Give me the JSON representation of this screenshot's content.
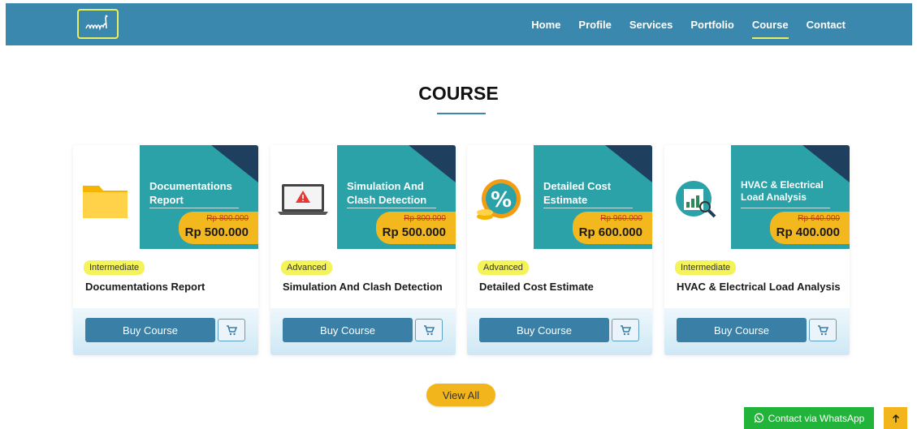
{
  "nav": {
    "items": [
      {
        "label": "Home",
        "active": false
      },
      {
        "label": "Profile",
        "active": false
      },
      {
        "label": "Services",
        "active": false
      },
      {
        "label": "Portfolio",
        "active": false
      },
      {
        "label": "Course",
        "active": true
      },
      {
        "label": "Contact",
        "active": false
      }
    ]
  },
  "section": {
    "title": "COURSE"
  },
  "courses": [
    {
      "thumb_title": "Documentations Report",
      "old_price": "Rp 800.000",
      "new_price": "Rp 500.000",
      "level": "Intermediate",
      "name": "Documentations Report",
      "icon": "folder-icon"
    },
    {
      "thumb_title": "Simulation And Clash Detection",
      "old_price": "Rp 800.000",
      "new_price": "Rp 500.000",
      "level": "Advanced",
      "name": "Simulation And Clash Detection",
      "icon": "laptop-warning-icon"
    },
    {
      "thumb_title": "Detailed Cost Estimate",
      "old_price": "Rp 960.000",
      "new_price": "Rp 600.000",
      "level": "Advanced",
      "name": "Detailed Cost Estimate",
      "icon": "percent-coins-icon"
    },
    {
      "thumb_title": "HVAC & Electrical Load Analysis",
      "old_price": "Rp 640.000",
      "new_price": "Rp 400.000",
      "level": "Intermediate",
      "name": "HVAC & Electrical Load Analysis",
      "icon": "analysis-chart-icon"
    }
  ],
  "buttons": {
    "buy_label": "Buy Course",
    "view_all": "View All",
    "whatsapp": "Contact via WhatsApp"
  },
  "colors": {
    "navbar": "#3a88ad",
    "accent_yellow": "#f2b61c",
    "teal": "#2aa2a8",
    "whatsapp_green": "#22b33a"
  }
}
